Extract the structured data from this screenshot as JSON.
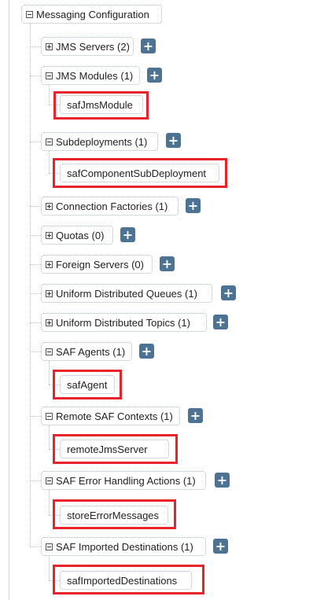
{
  "root": {
    "label": "Messaging Configuration",
    "expanded": true
  },
  "items": [
    {
      "label": "JMS Servers (2)",
      "expanded": false,
      "add": "+"
    },
    {
      "label": "JMS Modules (1)",
      "expanded": true,
      "add": "+",
      "child": "safJmsModule"
    },
    {
      "label": "Subdeployments (1)",
      "expanded": true,
      "add": "+",
      "child": "safComponentSubDeployment"
    },
    {
      "label": "Connection Factories (1)",
      "expanded": false,
      "add": "+"
    },
    {
      "label": "Quotas (0)",
      "expanded": false,
      "add": "+"
    },
    {
      "label": "Foreign Servers (0)",
      "expanded": false,
      "add": "+"
    },
    {
      "label": "Uniform Distributed Queues (1)",
      "expanded": false,
      "add": "+"
    },
    {
      "label": "Uniform Distributed Topics (1)",
      "expanded": false,
      "add": "+"
    },
    {
      "label": "SAF Agents (1)",
      "expanded": true,
      "add": "+",
      "child": "safAgent"
    },
    {
      "label": "Remote SAF Contexts (1)",
      "expanded": true,
      "add": "+",
      "child": "remoteJmsServer"
    },
    {
      "label": "SAF Error Handling Actions (1)",
      "expanded": true,
      "add": "+",
      "child": "storeErrorMessages"
    },
    {
      "label": "SAF Imported Destinations (1)",
      "expanded": true,
      "add": "+",
      "child": "safImportedDestinations"
    }
  ],
  "colors": {
    "highlight": "#e8232b",
    "add_button": "#4c7394"
  }
}
